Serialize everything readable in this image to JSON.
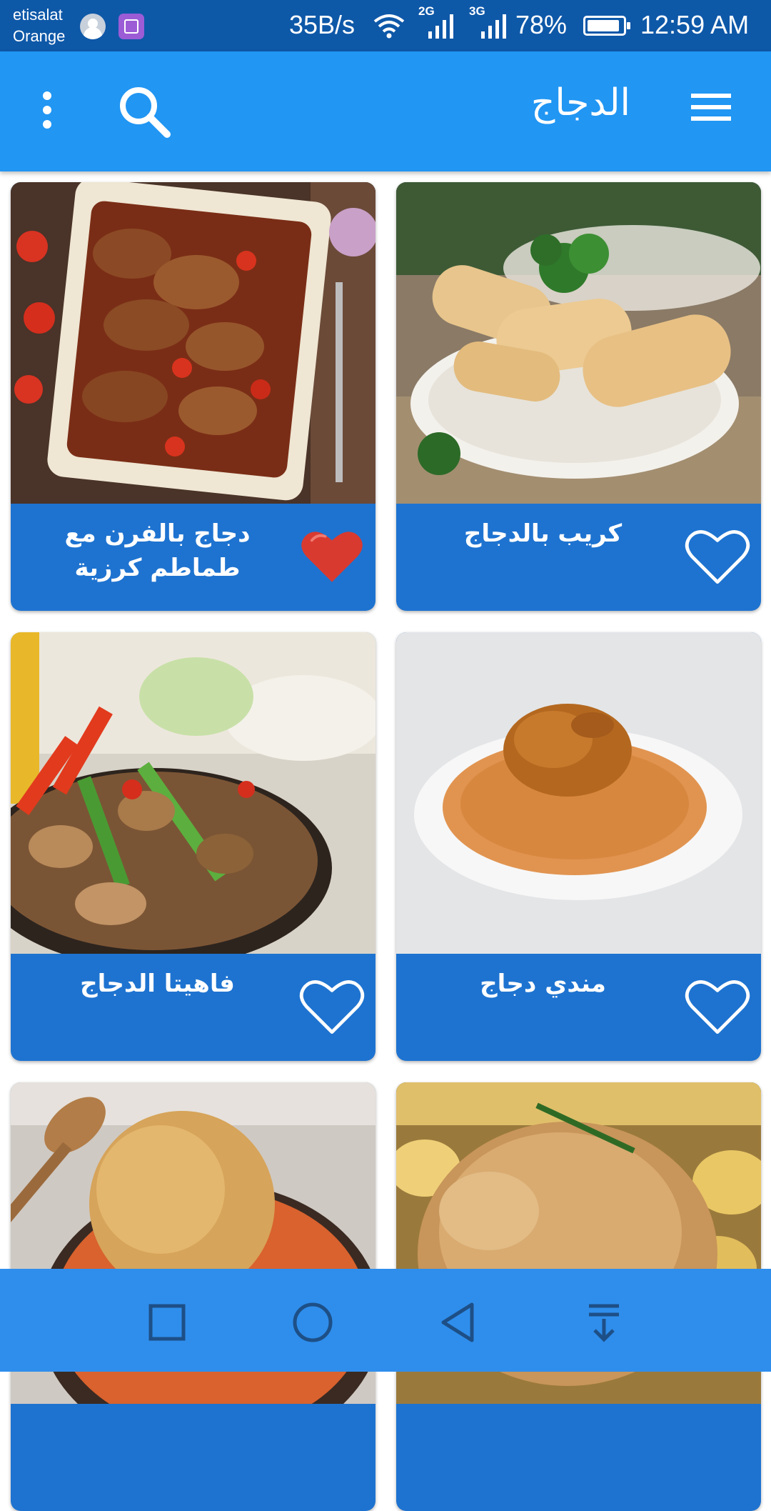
{
  "status_bar": {
    "carrier_line1": "etisalat",
    "carrier_line2": "Orange",
    "net_speed": "35B/s",
    "net1": "2G",
    "net2": "3G",
    "battery": "78%",
    "time": "12:59 AM"
  },
  "app_bar": {
    "title": "الدجاج",
    "menu_icon": "hamburger-menu-icon",
    "search_icon": "search-icon",
    "overflow_icon": "more-vertical-icon"
  },
  "recipes": [
    {
      "title": "كريب بالدجاج",
      "favorite": false,
      "photo": "crepe-photo"
    },
    {
      "title": "دجاج بالفرن مع طماطم كرزية",
      "favorite": true,
      "photo": "oven-chicken-photo"
    },
    {
      "title": "مندي دجاج",
      "favorite": false,
      "photo": "mandi-photo"
    },
    {
      "title": "فاهيتا الدجاج",
      "favorite": false,
      "photo": "fajita-photo"
    },
    {
      "title": "",
      "favorite": false,
      "photo": "roast-chicken-photo"
    },
    {
      "title": "",
      "favorite": false,
      "photo": "chicken-rice-photo"
    }
  ],
  "colors": {
    "status_bar": "#0e58a8",
    "app_bar": "#2196f3",
    "card_caption": "#1e73d0",
    "nav_bar": "#2f8eec",
    "heart_filled": "#d93a30"
  },
  "nav_bar": {
    "recents_icon": "square-recents-icon",
    "home_icon": "circle-home-icon",
    "back_icon": "triangle-back-icon",
    "notification_icon": "pull-down-notifications-icon"
  }
}
